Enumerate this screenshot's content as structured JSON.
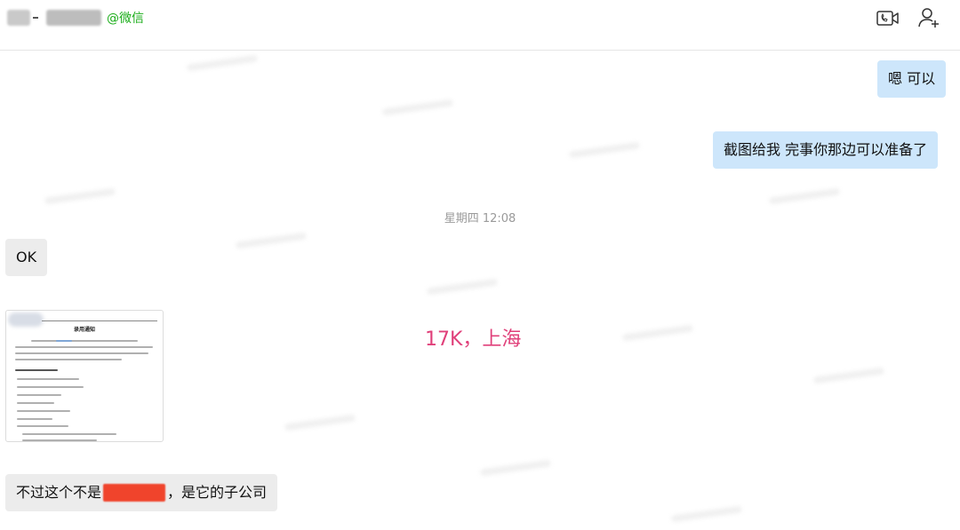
{
  "header": {
    "wechat_tag": "@微信"
  },
  "messages": [
    {
      "side": "outgoing",
      "text": "嗯 可以"
    },
    {
      "side": "outgoing",
      "text": "截图给我 完事你那边可以准备了"
    },
    {
      "side": "incoming",
      "text": "OK"
    },
    {
      "side": "incoming",
      "type": "image",
      "doc_title": "录用通知"
    },
    {
      "side": "incoming",
      "text_before": "不过这个不是",
      "text_after": "，是它的子公司"
    }
  ],
  "timestamp": "星期四 12:08",
  "overlay": "17K，上海",
  "colors": {
    "accent_green": "#1aad19",
    "outgoing_bubble": "#cde6fb",
    "incoming_bubble": "#ececec",
    "overlay_text": "#e0407a",
    "redaction": "#f0442c"
  },
  "icons": [
    "video-call-icon",
    "add-contact-icon"
  ]
}
